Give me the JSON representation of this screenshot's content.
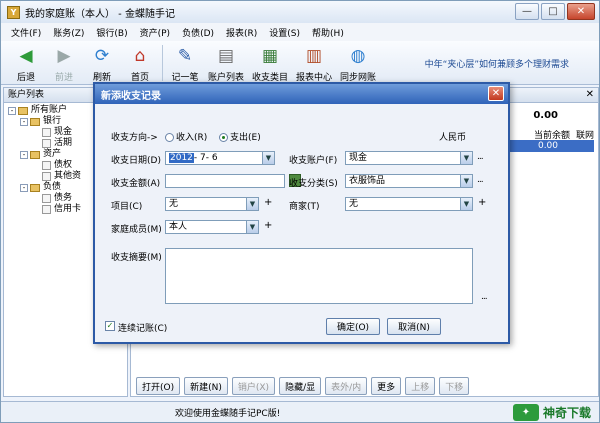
{
  "window": {
    "title": "我的家庭账（本人） - 金蝶随手记",
    "min": "—",
    "max": "□",
    "close": "✕"
  },
  "menu": [
    "文件(F)",
    "账务(Z)",
    "银行(B)",
    "资产(P)",
    "负债(D)",
    "报表(R)",
    "设置(S)",
    "帮助(H)"
  ],
  "toolbar": {
    "buttons": [
      {
        "label": "后退",
        "icon": "◀",
        "color": "#2e9b3a"
      },
      {
        "label": "前进",
        "icon": "▶",
        "color": "#9aa8a8"
      },
      {
        "label": "刷新",
        "icon": "⟳",
        "color": "#2e7fcf"
      },
      {
        "label": "首页",
        "icon": "⌂",
        "color": "#c0392b"
      },
      {
        "label": "记一笔",
        "icon": "✎",
        "color": "#2f5fa8"
      },
      {
        "label": "账户列表",
        "icon": "▤",
        "color": "#6b6b6b"
      },
      {
        "label": "收支类目",
        "icon": "▦",
        "color": "#3a7d3a"
      },
      {
        "label": "报表中心",
        "icon": "▥",
        "color": "#b04d2a"
      },
      {
        "label": "同步网账",
        "icon": "◍",
        "color": "#2e7fcf"
      }
    ],
    "note": "中年“夹心层”如何兼顾多个理财需求"
  },
  "left_panel": {
    "title": "账户列表",
    "tree": [
      {
        "label": "所有账户",
        "level": 0,
        "toggle": "-"
      },
      {
        "label": "银行",
        "level": 1,
        "toggle": "-"
      },
      {
        "label": "现金",
        "level": 2,
        "toggle": ""
      },
      {
        "label": "活期",
        "level": 2,
        "toggle": ""
      },
      {
        "label": "资产",
        "level": 1,
        "toggle": "-"
      },
      {
        "label": "债权",
        "level": 2,
        "toggle": ""
      },
      {
        "label": "其他资",
        "level": 2,
        "toggle": ""
      },
      {
        "label": "负债",
        "level": 1,
        "toggle": "-"
      },
      {
        "label": "债务",
        "level": 2,
        "toggle": ""
      },
      {
        "label": "信用卡",
        "level": 2,
        "toggle": ""
      }
    ]
  },
  "right_panel": {
    "close": "✕",
    "total": "0.00",
    "headers": [
      "当前余额",
      "联网"
    ],
    "selected_value": "0.00"
  },
  "bottom_buttons": [
    {
      "label": "打开(O)",
      "disabled": false
    },
    {
      "label": "新建(N)",
      "disabled": false
    },
    {
      "label": "销户(X)",
      "disabled": true
    },
    {
      "label": "隐藏/显",
      "disabled": false
    },
    {
      "label": "表外/内",
      "disabled": true
    },
    {
      "label": "更多",
      "disabled": false
    },
    {
      "label": "上移",
      "disabled": true
    },
    {
      "label": "下移",
      "disabled": true
    }
  ],
  "status": {
    "text": "欢迎使用金蝶随手记PC版!",
    "logo_mark": "✦",
    "logo_text": "神奇下载"
  },
  "dialog": {
    "title": "新添收支记录",
    "close": "✕",
    "direction_label": "收支方向->",
    "radio_income": "收入(R)",
    "radio_expense": "支出(E)",
    "currency": "人民币",
    "date_label": "收支日期(D)",
    "date_year": "2012",
    "date_rest": "- 7- 6",
    "account_label": "收支账户(F)",
    "account_value": "现金",
    "amount_label": "收支金额(A)",
    "amount_value": "",
    "category_label": "收支分类(S)",
    "category_value": "衣服饰品",
    "project_label": "项目(C)",
    "project_value": "无",
    "merchant_label": "商家(T)",
    "merchant_value": "无",
    "member_label": "家庭成员(M)",
    "member_value": "本人",
    "memo_label": "收支摘要(M)",
    "memo_value": "",
    "continue_label": "连续记账(C)",
    "ok": "确定(O)",
    "cancel": "取消(N)",
    "more": "..."
  }
}
